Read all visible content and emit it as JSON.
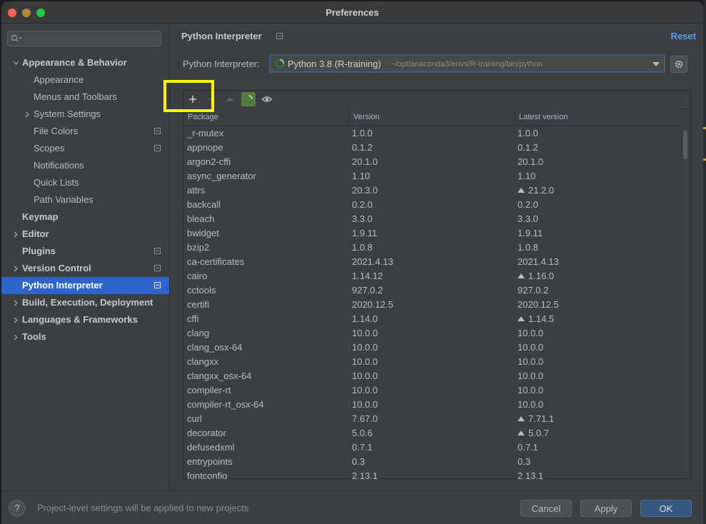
{
  "window": {
    "title": "Preferences"
  },
  "sidebar": {
    "search_placeholder": "",
    "items": [
      {
        "label": "Appearance & Behavior",
        "bold": true,
        "expanded": true,
        "project": false
      },
      {
        "label": "Appearance",
        "bold": false,
        "project": false
      },
      {
        "label": "Menus and Toolbars",
        "bold": false,
        "project": false
      },
      {
        "label": "System Settings",
        "bold": false,
        "collapsed": true,
        "project": false
      },
      {
        "label": "File Colors",
        "bold": false,
        "project": true
      },
      {
        "label": "Scopes",
        "bold": false,
        "project": true
      },
      {
        "label": "Notifications",
        "bold": false,
        "project": false
      },
      {
        "label": "Quick Lists",
        "bold": false,
        "project": false
      },
      {
        "label": "Path Variables",
        "bold": false,
        "project": false
      },
      {
        "label": "Keymap",
        "bold": true,
        "project": false
      },
      {
        "label": "Editor",
        "bold": true,
        "collapsed": true,
        "project": false
      },
      {
        "label": "Plugins",
        "bold": true,
        "project": true
      },
      {
        "label": "Version Control",
        "bold": true,
        "collapsed": true,
        "project": true
      },
      {
        "label": "Python Interpreter",
        "bold": true,
        "selected": true,
        "project": true
      },
      {
        "label": "Build, Execution, Deployment",
        "bold": true,
        "collapsed": true,
        "project": false
      },
      {
        "label": "Languages & Frameworks",
        "bold": true,
        "collapsed": true,
        "project": false
      },
      {
        "label": "Tools",
        "bold": true,
        "collapsed": true,
        "project": false
      }
    ]
  },
  "main": {
    "breadcrumb": "Python Interpreter",
    "reset_label": "Reset",
    "interpreter_label": "Python Interpreter:",
    "interpreter_name": "Python 3.8 (R-training)",
    "interpreter_path": "~/opt/anaconda3/envs/R-training/bin/python",
    "columns": [
      "Package",
      "Version",
      "Latest version"
    ],
    "packages": [
      {
        "name": "_r-mutex",
        "version": "1.0.0",
        "latest": "1.0.0",
        "upgrade": false
      },
      {
        "name": "appnope",
        "version": "0.1.2",
        "latest": "0.1.2",
        "upgrade": false
      },
      {
        "name": "argon2-cffi",
        "version": "20.1.0",
        "latest": "20.1.0",
        "upgrade": false
      },
      {
        "name": "async_generator",
        "version": "1.10",
        "latest": "1.10",
        "upgrade": false
      },
      {
        "name": "attrs",
        "version": "20.3.0",
        "latest": "21.2.0",
        "upgrade": true
      },
      {
        "name": "backcall",
        "version": "0.2.0",
        "latest": "0.2.0",
        "upgrade": false
      },
      {
        "name": "bleach",
        "version": "3.3.0",
        "latest": "3.3.0",
        "upgrade": false
      },
      {
        "name": "bwidget",
        "version": "1.9.11",
        "latest": "1.9.11",
        "upgrade": false
      },
      {
        "name": "bzip2",
        "version": "1.0.8",
        "latest": "1.0.8",
        "upgrade": false
      },
      {
        "name": "ca-certificates",
        "version": "2021.4.13",
        "latest": "2021.4.13",
        "upgrade": false
      },
      {
        "name": "cairo",
        "version": "1.14.12",
        "latest": "1.16.0",
        "upgrade": true
      },
      {
        "name": "cctools",
        "version": "927.0.2",
        "latest": "927.0.2",
        "upgrade": false
      },
      {
        "name": "certifi",
        "version": "2020.12.5",
        "latest": "2020.12.5",
        "upgrade": false
      },
      {
        "name": "cffi",
        "version": "1.14.0",
        "latest": "1.14.5",
        "upgrade": true
      },
      {
        "name": "clang",
        "version": "10.0.0",
        "latest": "10.0.0",
        "upgrade": false
      },
      {
        "name": "clang_osx-64",
        "version": "10.0.0",
        "latest": "10.0.0",
        "upgrade": false
      },
      {
        "name": "clangxx",
        "version": "10.0.0",
        "latest": "10.0.0",
        "upgrade": false
      },
      {
        "name": "clangxx_osx-64",
        "version": "10.0.0",
        "latest": "10.0.0",
        "upgrade": false
      },
      {
        "name": "compiler-rt",
        "version": "10.0.0",
        "latest": "10.0.0",
        "upgrade": false
      },
      {
        "name": "compiler-rt_osx-64",
        "version": "10.0.0",
        "latest": "10.0.0",
        "upgrade": false
      },
      {
        "name": "curl",
        "version": "7.67.0",
        "latest": "7.71.1",
        "upgrade": true
      },
      {
        "name": "decorator",
        "version": "5.0.6",
        "latest": "5.0.7",
        "upgrade": true
      },
      {
        "name": "defusedxml",
        "version": "0.7.1",
        "latest": "0.7.1",
        "upgrade": false
      },
      {
        "name": "entrypoints",
        "version": "0.3",
        "latest": "0.3",
        "upgrade": false
      },
      {
        "name": "fontconfig",
        "version": "2.13.1",
        "latest": "2.13.1",
        "upgrade": false
      }
    ]
  },
  "footer": {
    "help_label": "?",
    "note": "Project-level settings will be applied to new projects",
    "cancel_label": "Cancel",
    "apply_label": "Apply",
    "ok_label": "OK"
  },
  "colors": {
    "accent": "#2f65ca",
    "link": "#589df6",
    "highlight": "#f7f701",
    "ok_button": "#365880"
  }
}
